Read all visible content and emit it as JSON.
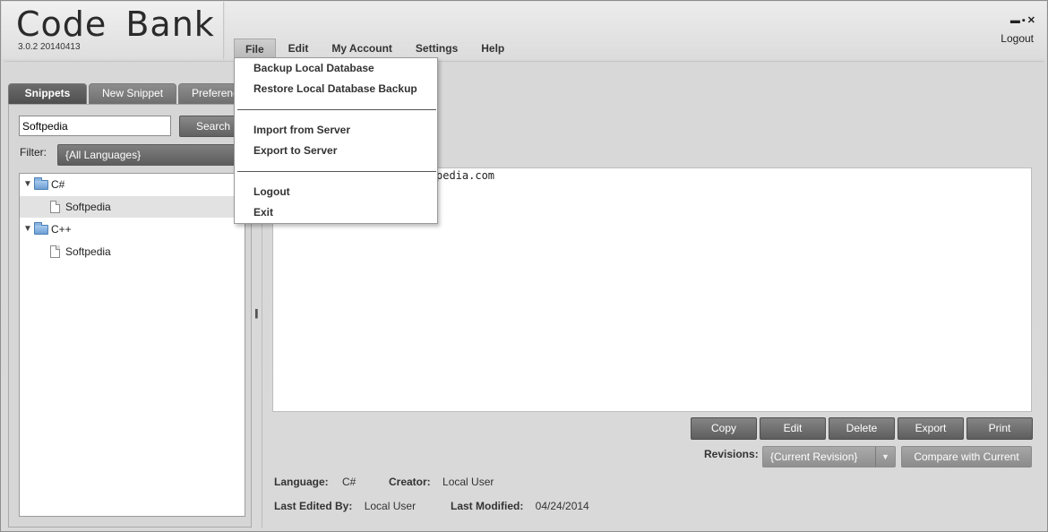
{
  "app": {
    "title": "Code Bank",
    "version": "3.0.2 20140413",
    "window_controls": "▬▪✕",
    "logout": "Logout"
  },
  "menubar": {
    "items": [
      {
        "label": "File"
      },
      {
        "label": "Edit"
      },
      {
        "label": "My Account"
      },
      {
        "label": "Settings"
      },
      {
        "label": "Help"
      }
    ]
  },
  "file_menu": {
    "items": [
      "Backup Local Database",
      "Restore Local Database Backup",
      "Import from Server",
      "Export to Server",
      "Logout",
      "Exit"
    ]
  },
  "tabs": [
    "Snippets",
    "New Snippet",
    "Preferenc"
  ],
  "search": {
    "value": "Softpedia",
    "button": "Search"
  },
  "filter": {
    "label": "Filter:",
    "selected": "{All Languages}"
  },
  "tree": {
    "nodes": [
      {
        "label": "C#",
        "type": "folder"
      },
      {
        "label": "Softpedia",
        "type": "file",
        "selected": true
      },
      {
        "label": "C++",
        "type": "folder"
      },
      {
        "label": "Softpedia",
        "type": "file"
      }
    ]
  },
  "splitter_glyph": "|||",
  "editor": {
    "code": "pedia.com"
  },
  "actions": [
    "Copy",
    "Edit",
    "Delete",
    "Export",
    "Print"
  ],
  "revisions": {
    "label": "Revisions:",
    "selected": "{Current Revision}",
    "compare": "Compare with Current"
  },
  "details": {
    "language_label": "Language:",
    "language": "C#",
    "creator_label": "Creator:",
    "creator": "Local User",
    "last_edited_by_label": "Last Edited By:",
    "last_edited_by": "Local User",
    "last_modified_label": "Last Modified:",
    "last_modified": "04/24/2014"
  },
  "colors": {
    "menu_active": "#bfbfbf",
    "tab": "#6f6f6f",
    "button": "#6e6e6e"
  }
}
